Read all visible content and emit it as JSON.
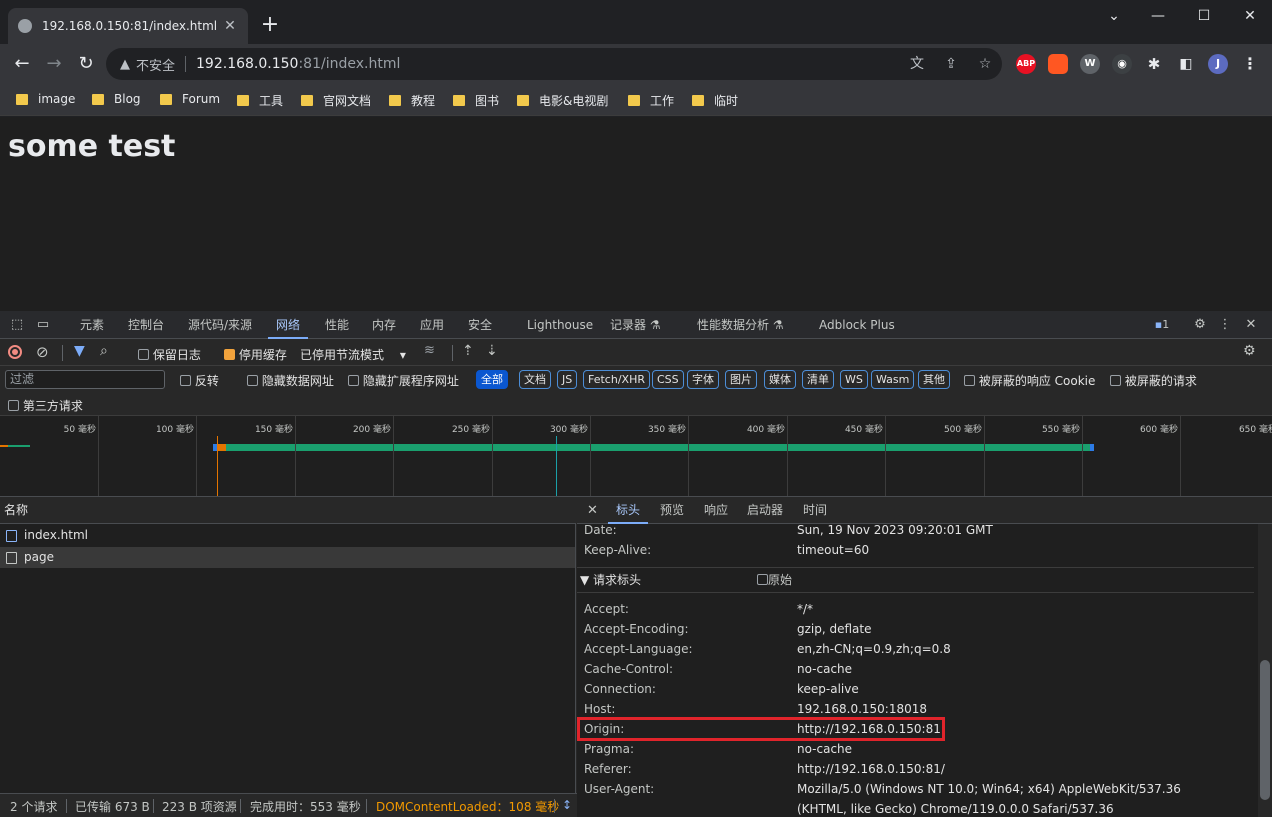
{
  "browser": {
    "tab_title": "192.168.0.150:81/index.html",
    "tab_close": "✕",
    "new_tab": "+",
    "window_controls": {
      "minimize": "⌄",
      "restore": "—",
      "maximize": "☐",
      "close": "✕"
    },
    "nav": {
      "back": "←",
      "forward": "→",
      "reload": "↻"
    },
    "omnibox": {
      "security_label": "不安全",
      "host": "192.168.0.150",
      "path": ":81/index.html",
      "icons": [
        "translate-icon",
        "share-icon",
        "star-icon"
      ]
    },
    "extensions": [
      {
        "name": "adblock-plus-icon",
        "label": "ABP",
        "color": "#e81123"
      },
      {
        "name": "extension-orange-icon",
        "label": "",
        "color": "#ff5722"
      },
      {
        "name": "extension-w-icon",
        "label": "W",
        "color": "#5f6368"
      },
      {
        "name": "extension-eyes-icon",
        "label": "",
        "color": "#3c4043"
      }
    ],
    "profile_initial": "J",
    "bookmarks": [
      "image",
      "Blog",
      "Forum",
      "工具",
      "官网文档",
      "教程",
      "图书",
      "电影&电视剧",
      "工作",
      "临时"
    ]
  },
  "page": {
    "heading": "some test"
  },
  "devtools": {
    "tabs": [
      "元素",
      "控制台",
      "源代码/来源",
      "网络",
      "性能",
      "内存",
      "应用",
      "安全",
      "Lighthouse",
      "记录器 ⚗",
      "性能数据分析 ⚗",
      "Adblock Plus"
    ],
    "active_tab": "网络",
    "issues_count": "1",
    "toolbar": {
      "preserve_log": "保留日志",
      "disable_cache": "停用缓存",
      "throttle": "已停用节流模式"
    },
    "filter": {
      "placeholder": "过滤",
      "invert": "反转",
      "hide_data_urls": "隐藏数据网址",
      "hide_extension_urls": "隐藏扩展程序网址",
      "types": [
        "全部",
        "文档",
        "JS",
        "Fetch/XHR",
        "CSS",
        "字体",
        "图片",
        "媒体",
        "清单",
        "WS",
        "Wasm",
        "其他"
      ],
      "blocked_cookies": "被屏蔽的响应 Cookie",
      "blocked_requests": "被屏蔽的请求",
      "third_party": "第三方请求"
    },
    "timeline": {
      "ticks": [
        "50 毫秒",
        "100 毫秒",
        "150 毫秒",
        "200 毫秒",
        "250 毫秒",
        "300 毫秒",
        "350 毫秒",
        "400 毫秒",
        "450 毫秒",
        "500 毫秒",
        "550 毫秒",
        "600 毫秒",
        "650 毫秒"
      ]
    },
    "requests": {
      "column_name": "名称",
      "rows": [
        "index.html",
        "page"
      ],
      "selected": "page"
    },
    "detail": {
      "tabs": [
        "标头",
        "预览",
        "响应",
        "启动器",
        "时间"
      ],
      "active_tab": "标头",
      "close": "✕",
      "response_headers_tail": [
        {
          "k": "Date:",
          "v": "Sun, 19 Nov 2023 09:20:01 GMT"
        },
        {
          "k": "Keep-Alive:",
          "v": "timeout=60"
        }
      ],
      "request_section_title": "▼ 请求标头",
      "raw_label": "原始",
      "request_headers": [
        {
          "k": "Accept:",
          "v": "*/*"
        },
        {
          "k": "Accept-Encoding:",
          "v": "gzip, deflate"
        },
        {
          "k": "Accept-Language:",
          "v": "en,zh-CN;q=0.9,zh;q=0.8"
        },
        {
          "k": "Cache-Control:",
          "v": "no-cache"
        },
        {
          "k": "Connection:",
          "v": "keep-alive"
        },
        {
          "k": "Host:",
          "v": "192.168.0.150:18018"
        },
        {
          "k": "Origin:",
          "v": "http://192.168.0.150:81"
        },
        {
          "k": "Pragma:",
          "v": "no-cache"
        },
        {
          "k": "Referer:",
          "v": "http://192.168.0.150:81/"
        },
        {
          "k": "User-Agent:",
          "v": "Mozilla/5.0 (Windows NT 10.0; Win64; x64) AppleWebKit/537.36 (KHTML, like Gecko) Chrome/119.0.0.0 Safari/537.36"
        }
      ]
    },
    "status": {
      "requests": "2 个请求",
      "transferred": "已传输 673 B",
      "resources": "223 B 项资源",
      "finish": "完成用时：553 毫秒",
      "dcl": "DOMContentLoaded：108 毫秒"
    }
  }
}
